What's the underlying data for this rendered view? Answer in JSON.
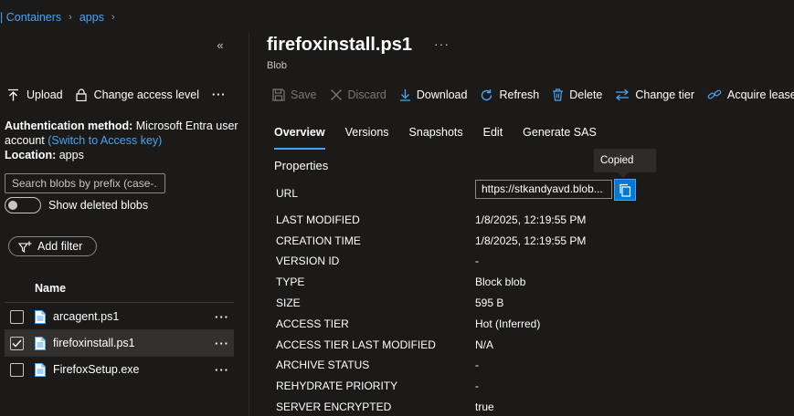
{
  "breadcrumb": {
    "items": [
      "| Containers",
      "apps"
    ]
  },
  "left_pane": {
    "toolbar": {
      "upload": "Upload",
      "change_access_level": "Change access level",
      "more": "···"
    },
    "auth": {
      "method_label": "Authentication method:",
      "method_value": "Microsoft Entra user account",
      "switch_link": "(Switch to Access key)",
      "location_label": "Location:",
      "location_value": "apps"
    },
    "search": {
      "placeholder": "Search blobs by prefix (case-..."
    },
    "show_deleted": {
      "label": "Show deleted blobs",
      "enabled": false
    },
    "filter_button": "Add filter",
    "list_header": "Name",
    "files": [
      {
        "name": "arcagent.ps1",
        "selected": false
      },
      {
        "name": "firefoxinstall.ps1",
        "selected": true
      },
      {
        "name": "FirefoxSetup.exe",
        "selected": false
      }
    ]
  },
  "blob": {
    "title": "firefoxinstall.ps1",
    "subtitle": "Blob",
    "more": "···"
  },
  "command_bar": {
    "save": "Save",
    "discard": "Discard",
    "download": "Download",
    "refresh": "Refresh",
    "delete": "Delete",
    "change_tier": "Change tier",
    "acquire_lease": "Acquire lease"
  },
  "tabs": [
    "Overview",
    "Versions",
    "Snapshots",
    "Edit",
    "Generate SAS"
  ],
  "active_tab": "Overview",
  "properties": {
    "title": "Properties",
    "url_label": "URL",
    "url_value": "https://stkandyavd.blob...",
    "copy_tooltip": "Copied",
    "rows": [
      {
        "label": "LAST MODIFIED",
        "value": "1/8/2025, 12:19:55 PM"
      },
      {
        "label": "CREATION TIME",
        "value": "1/8/2025, 12:19:55 PM"
      },
      {
        "label": "VERSION ID",
        "value": "-"
      },
      {
        "label": "TYPE",
        "value": "Block blob"
      },
      {
        "label": "SIZE",
        "value": "595 B"
      },
      {
        "label": "ACCESS TIER",
        "value": "Hot (Inferred)"
      },
      {
        "label": "ACCESS TIER LAST MODIFIED",
        "value": "N/A"
      },
      {
        "label": "ARCHIVE STATUS",
        "value": "-"
      },
      {
        "label": "REHYDRATE PRIORITY",
        "value": "-"
      },
      {
        "label": "SERVER ENCRYPTED",
        "value": "true"
      }
    ]
  },
  "colors": {
    "accent": "#0078d4",
    "link": "#4aa3f0",
    "background": "#1b1a19"
  },
  "icons": {
    "upload": "upload-icon",
    "lock": "lock-icon",
    "save": "save-icon",
    "discard": "close-icon",
    "download": "download-icon",
    "refresh": "refresh-icon",
    "delete": "trash-icon",
    "change_tier": "swap-arrows-icon",
    "acquire_lease": "link-icon",
    "copy": "copy-icon",
    "file": "file-icon",
    "filter": "filter-icon",
    "collapse": "double-chevron-left-icon"
  }
}
